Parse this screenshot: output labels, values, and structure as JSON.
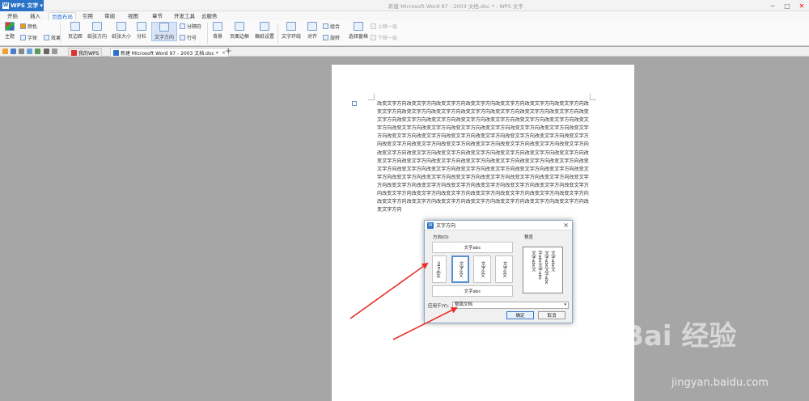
{
  "app": {
    "name": "WPS 文字",
    "logo": "W",
    "window_title": "新建 Microsoft Word 97 - 2003 文档.doc * - WPS 文字"
  },
  "menu": {
    "tabs": [
      "开始",
      "插入",
      "页面布局",
      "引用",
      "审阅",
      "视图",
      "章节",
      "开发工具",
      "云服务"
    ],
    "active": "页面布局"
  },
  "ribbon": {
    "theme": "主题",
    "color": "颜色",
    "font": "字体",
    "effect": "效果",
    "margin": "页边距",
    "orientation": "纸张方向",
    "size": "纸张大小",
    "columns": "分栏",
    "text_direction": "文字方向",
    "line_num": "行号",
    "separator": "分隔符",
    "background": "背景",
    "page_border": "页面边框",
    "manuscript": "稿纸设置",
    "wrap": "文字环绕",
    "align": "对齐",
    "rotate": "旋转",
    "group": "组合",
    "select_pane": "选择窗格",
    "up_layer": "上移一层",
    "down_layer": "下移一层"
  },
  "doc_tabs": [
    {
      "label": "我的WPS"
    },
    {
      "label": "新建 Microsoft Word 97 - 2003 文档.doc *"
    }
  ],
  "document": {
    "body": "改变文字方向改变文字方向改变文字方向改变文字方向改变文字方向改变文字方向改变文字方向改变文字方向改变文字方向改变文字方向改变文字方向改变文字方向改变文字方向改变文字方向改变文字方向改变文字方向改变文字方向改变文字方向改变文字方向改变文字方向改变文字方向改变文字方向改变文字方向改变文字方向改变文字方向改变文字方向改变文字方向改变文字方向改变文字方向改变文字方向改变文字方向改变文字方向改变文字方向改变文字方向改变文字方向改变文字方向改变文字方向改变文字方向改变文字方向改变文字方向改变文字方向改变文字方向改变文字方向改变文字方向改变文字方向改变文字方向改变文字方向改变文字方向改变文字方向改变文字方向改变文字方向改变文字方向改变文字方向改变文字方向改变文字方向改变文字方向改变文字方向改变文字方向改变文字方向改变文字方向改变文字方向改变文字方向改变文字方向改变文字方向改变文字方向改变文字方向改变文字方向改变文字方向改变文字方向改变文字方向改变文字方向改变文字方向改变文字方向改变文字方向改变文字方向改变文字方向改变文字方向改变文字方向改变文字方向改变文字方向改变文字方向改变文字方向改变文字方向改变文字方向改变文字方向改变文字方向改变文字方向改变文字方向改变文字方向改变文字方向改变文字方向改变文字方向改变文字方向改变文字方向"
  },
  "dialog": {
    "title": "文字方向",
    "direction_label": "方向(O)",
    "preview_label": "预览",
    "options": [
      "文字abc",
      "文字abc",
      "文字abc",
      "文字abc",
      "文字abc",
      "文字abc"
    ],
    "preview_lines": [
      "文字abc文",
      "字abc文字abc",
      "文字abc文字abc",
      "文字abc文"
    ],
    "apply_label": "应用于(Y):",
    "apply_value": "整篇文档",
    "ok": "确定",
    "cancel": "取消"
  },
  "watermark": {
    "brand": "Bai 经验",
    "url": "jingyan.baidu.com"
  },
  "colors": {
    "accent": "#2b73c6",
    "arrow": "#e8302a"
  }
}
